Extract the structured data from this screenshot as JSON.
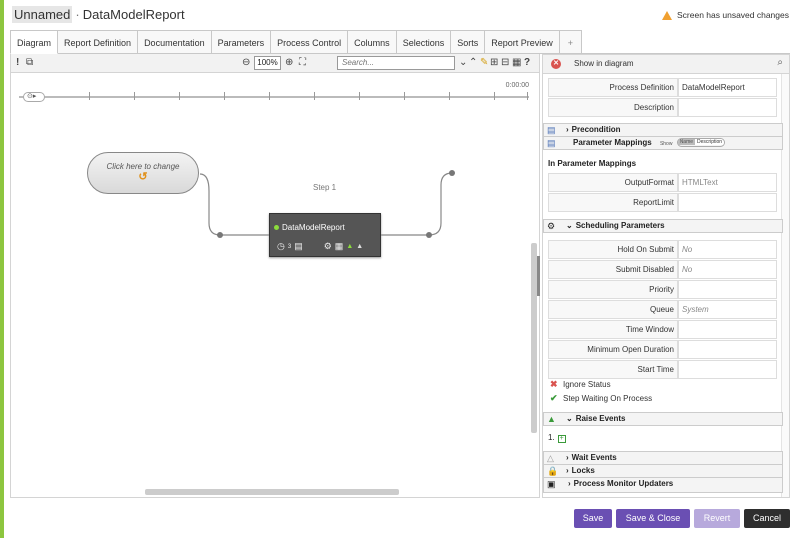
{
  "header": {
    "name": "Unnamed",
    "separator": "·",
    "title": "DataModelReport",
    "unsaved_text": "Screen has unsaved changes"
  },
  "tabs": [
    {
      "label": "Diagram",
      "active": true
    },
    {
      "label": "Report Definition"
    },
    {
      "label": "Documentation"
    },
    {
      "label": "Parameters"
    },
    {
      "label": "Process Control"
    },
    {
      "label": "Columns"
    },
    {
      "label": "Selections"
    },
    {
      "label": "Sorts"
    },
    {
      "label": "Report Preview"
    },
    {
      "label": "+"
    }
  ],
  "toolbar": {
    "zoom": "100%",
    "search_placeholder": "Search..."
  },
  "diagram": {
    "timeline_time": "0:00:00",
    "start_node_label": "Click here to change",
    "step_label": "Step 1",
    "task_name": "DataModelReport",
    "task_sub": "3"
  },
  "panel": {
    "show_in_diagram": "Show in diagram",
    "process_definition_label": "Process Definition",
    "process_definition_value": "DataModelReport",
    "description_label": "Description",
    "description_value": "",
    "precondition": "Precondition",
    "parameter_mappings": "Parameter Mappings",
    "show_label": "Show",
    "toggle_name": "Name",
    "toggle_description": "Description",
    "in_parameter_mappings": "In Parameter Mappings",
    "params": [
      {
        "label": "OutputFormat",
        "value": "HTMLText"
      },
      {
        "label": "ReportLimit",
        "value": ""
      }
    ],
    "scheduling_parameters": "Scheduling Parameters",
    "schedule": [
      {
        "label": "Hold On Submit",
        "value": "No"
      },
      {
        "label": "Submit Disabled",
        "value": "No"
      },
      {
        "label": "Priority",
        "value": ""
      },
      {
        "label": "Queue",
        "value": "System"
      },
      {
        "label": "Time Window",
        "value": ""
      },
      {
        "label": "Minimum Open Duration",
        "value": ""
      },
      {
        "label": "Start Time",
        "value": ""
      }
    ],
    "ignore_status": "Ignore Status",
    "step_waiting": "Step Waiting On Process",
    "raise_events": "Raise Events",
    "raise_item": "1.",
    "wait_events": "Wait Events",
    "locks": "Locks",
    "process_monitor_updaters": "Process Monitor Updaters"
  },
  "buttons": {
    "save": "Save",
    "save_close": "Save & Close",
    "revert": "Revert",
    "cancel": "Cancel"
  },
  "colors": {
    "accent_green": "#8dc63f",
    "primary_purple": "#6a4fb3",
    "disabled_purple": "#b7a9dc",
    "cancel_dark": "#2e2e2e",
    "warning": "#f0a030"
  }
}
